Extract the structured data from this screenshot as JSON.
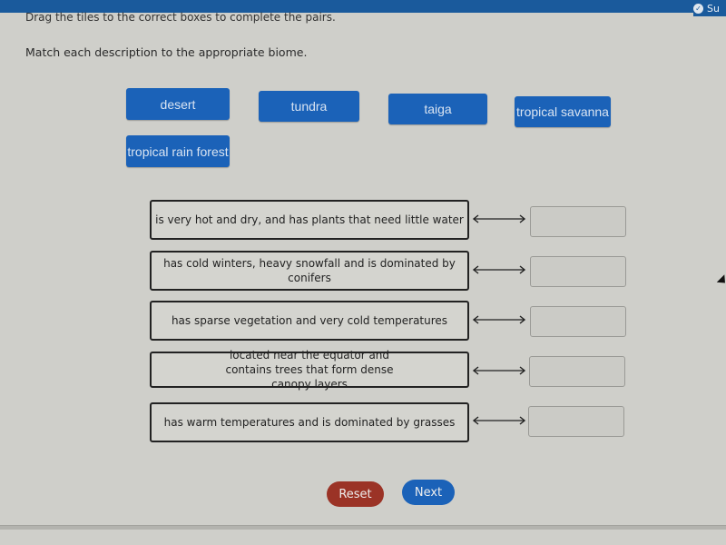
{
  "header": {
    "submit_label": "Su",
    "submit_icon": "check-circle-icon"
  },
  "instruction": "Drag the tiles to the correct boxes to complete the pairs.",
  "prompt": "Match each description to the appropriate biome.",
  "tiles": [
    {
      "label": "desert"
    },
    {
      "label": "tundra"
    },
    {
      "label": "taiga"
    },
    {
      "label": "tropical savanna"
    },
    {
      "label": "tropical rain forest"
    }
  ],
  "pairs": [
    {
      "description": "is very hot and dry, and has plants that need little water",
      "answer": ""
    },
    {
      "description": "has cold winters, heavy snowfall and is dominated by conifers",
      "answer": ""
    },
    {
      "description": "has sparse vegetation and very cold temperatures",
      "answer": ""
    },
    {
      "description": "located near the equator and contains trees that form dense canopy layers",
      "answer": ""
    },
    {
      "description": "has warm temperatures and is dominated by grasses",
      "answer": ""
    }
  ],
  "buttons": {
    "reset_label": "Reset",
    "next_label": "Next"
  },
  "colors": {
    "tile_blue": "#1b62b8",
    "reset_red": "#9b3326",
    "header_blue": "#1a5a9c"
  }
}
